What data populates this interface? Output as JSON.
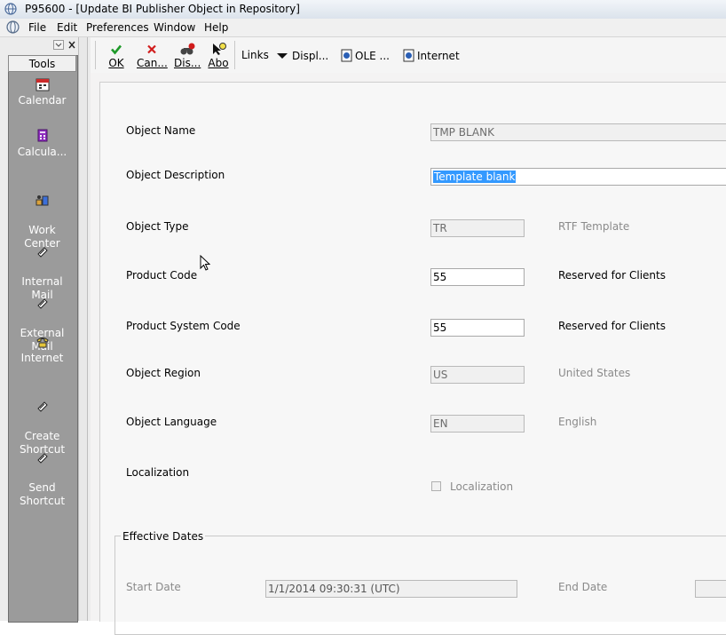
{
  "window": {
    "title": "P95600 - [Update BI Publisher Object in Repository]"
  },
  "menu": [
    "File",
    "Edit",
    "Preferences",
    "Window",
    "Help"
  ],
  "tools_panel": {
    "header": "Tools",
    "items": [
      {
        "label": "Calendar",
        "icon": "calendar-icon"
      },
      {
        "label": "Calcula...",
        "icon": "calculator-icon"
      },
      {
        "label": "Work\nCenter",
        "icon": "work-center-icon"
      },
      {
        "label": "Internal\nMail",
        "icon": "internal-mail-icon"
      },
      {
        "label": "External\nMail",
        "icon": "external-mail-icon"
      },
      {
        "label": "Internet",
        "icon": "phone-icon"
      },
      {
        "label": "Create\nShortcut",
        "icon": "shortcut-icon"
      },
      {
        "label": "Send\nShortcut",
        "icon": "shortcut-icon"
      }
    ]
  },
  "toolbar": {
    "ok": "OK",
    "cancel": "Can...",
    "display": "Dis...",
    "about": "Abo",
    "links": "Links",
    "displ": "Displ...",
    "ole": "OLE ...",
    "internet": "Internet"
  },
  "form": {
    "object_name": {
      "label": "Object Name",
      "value": "TMP BLANK"
    },
    "object_description": {
      "label": "Object Description",
      "value": "Template blank"
    },
    "object_type": {
      "label": "Object Type",
      "value": "TR",
      "description": "RTF Template"
    },
    "product_code": {
      "label": "Product Code",
      "value": "55",
      "description": "Reserved for Clients"
    },
    "product_system_code": {
      "label": "Product System Code",
      "value": "55",
      "description": "Reserved for Clients"
    },
    "object_region": {
      "label": "Object Region",
      "value": "US",
      "description": "United States"
    },
    "object_language": {
      "label": "Object Language",
      "value": "EN",
      "description": "English"
    },
    "localization": {
      "label": "Localization",
      "checkbox_label": "Localization",
      "checked": false
    },
    "effective_dates": {
      "title": "Effective Dates",
      "start_label": "Start Date",
      "start_value": "1/1/2014 09:30:31 (UTC)",
      "end_label": "End Date",
      "end_value": ""
    }
  },
  "colors": {
    "selection": "#3399ff",
    "ok_green": "#1f9a2a",
    "cancel_red": "#d11c1c",
    "tools_bg": "#9b9b9b"
  }
}
